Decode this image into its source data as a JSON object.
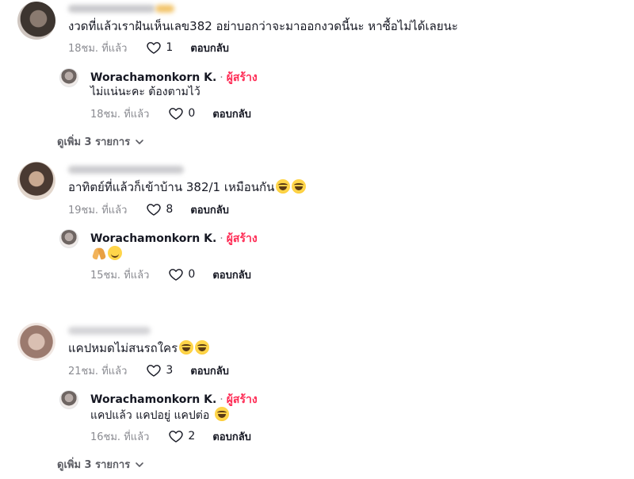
{
  "comments": [
    {
      "text": "งวดที่แล้วเราฝันเห็นเลข382 อย่าบอกว่าจะมาออกงวดนี้นะ หาซื้อไม่ได้เลยนะ",
      "time": "18ชม. ที่แล้ว",
      "likes": "1",
      "reply_label": "ตอบกลับ",
      "reply": {
        "username": "Worachamonkorn K.",
        "dot": "·",
        "badge": "ผู้สร้าง",
        "text": "ไม่แน่นะคะ ต้องตามไว้",
        "time": "18ชม. ที่แล้ว",
        "likes": "0",
        "reply_label": "ตอบกลับ"
      },
      "view_more": "ดูเพิ่ม 3 รายการ"
    },
    {
      "text": "อาทิตย์ที่แล้วก็เข้าบ้าน 382/1 เหมือนกัน",
      "time": "19ชม. ที่แล้ว",
      "likes": "8",
      "reply_label": "ตอบกลับ",
      "reply": {
        "username": "Worachamonkorn K.",
        "dot": "·",
        "badge": "ผู้สร้าง",
        "text": "",
        "time": "15ชม. ที่แล้ว",
        "likes": "0",
        "reply_label": "ตอบกลับ"
      }
    },
    {
      "text": "แคปหมดไม่สนรถใคร",
      "time": "21ชม. ที่แล้ว",
      "likes": "3",
      "reply_label": "ตอบกลับ",
      "reply": {
        "username": "Worachamonkorn K.",
        "dot": "·",
        "badge": "ผู้สร้าง",
        "text": "แคปแล้ว แคปอยู่ แคปต่อ",
        "time": "16ชม. ที่แล้ว",
        "likes": "2",
        "reply_label": "ตอบกลับ"
      },
      "view_more": "ดูเพิ่ม 3 รายการ"
    }
  ],
  "icons": {
    "like": "heart-outline-icon",
    "expand": "chevron-down-icon",
    "laugh": "face-with-tears-of-joy-emoji",
    "smile": "smiling-face-emoji",
    "pray": "folded-hands-emoji"
  },
  "colors": {
    "creator_badge": "#fe2c55",
    "meta_text": "#8a8b91",
    "primary_text": "#161823"
  }
}
